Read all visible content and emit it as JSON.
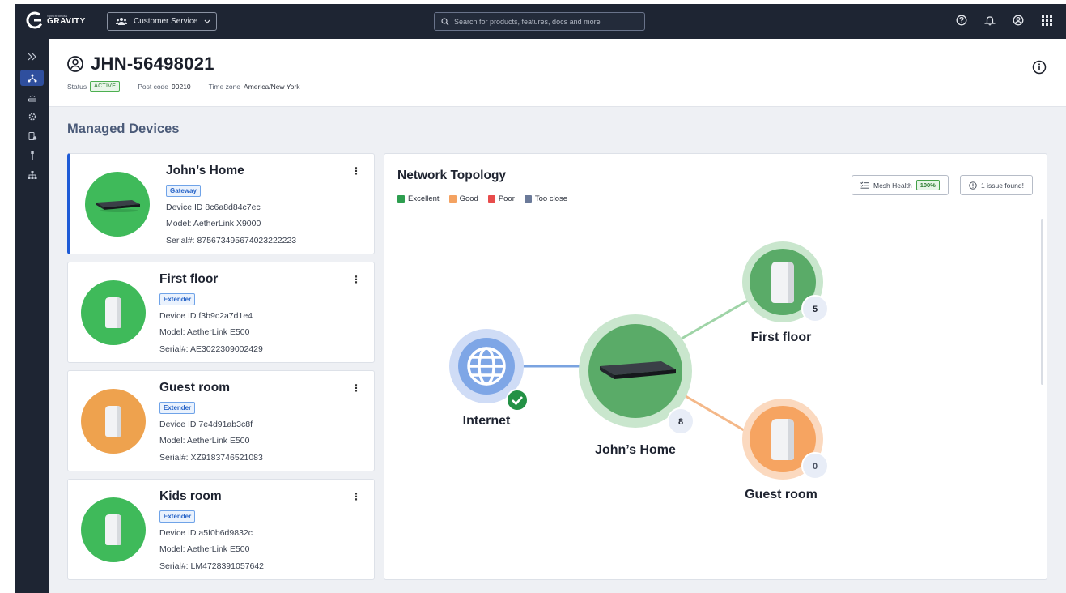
{
  "app": {
    "brand_small": "Synchronoss",
    "brand_name": "GRAVITY",
    "context_label": "Customer Service",
    "search_placeholder": "Search for products, features, docs and more"
  },
  "account": {
    "id": "JHN-56498021",
    "status_label": "Status",
    "status_value": "ACTIVE",
    "postcode_label": "Post code",
    "postcode_value": "90210",
    "timezone_label": "Time zone",
    "timezone_value": "America/New York"
  },
  "section_title": "Managed Devices",
  "devices": [
    {
      "name": "John’s Home",
      "type": "Gateway",
      "device_id": "Device ID 8c6a8d84c7ec",
      "model": "Model: AetherLink X9000",
      "serial": "Serial#: 875673495674023222223",
      "status_color": "#3fba5a"
    },
    {
      "name": "First floor",
      "type": "Extender",
      "device_id": "Device ID f3b9c2a7d1e4",
      "model": "Model: AetherLink E500",
      "serial": "Serial#: AE3022309002429",
      "status_color": "#3fba5a"
    },
    {
      "name": "Guest room",
      "type": "Extender",
      "device_id": "Device ID 7e4d91ab3c8f",
      "model": "Model: AetherLink E500",
      "serial": "Serial#: XZ9183746521083",
      "status_color": "#eea24e"
    },
    {
      "name": "Kids room",
      "type": "Extender",
      "device_id": "Device ID a5f0b6d9832c",
      "model": "Model: AetherLink E500",
      "serial": "Serial#: LM4728391057642",
      "status_color": "#3fba5a"
    }
  ],
  "topology": {
    "title": "Network Topology",
    "legend": [
      {
        "label": "Excellent",
        "color": "#2e9e4f"
      },
      {
        "label": "Good",
        "color": "#f4a261"
      },
      {
        "label": "Poor",
        "color": "#e84c4c"
      },
      {
        "label": "Too close",
        "color": "#6b7a99"
      }
    ],
    "mesh_health_label": "Mesh Health",
    "mesh_health_value": "100%",
    "issues_label": "1 issue found!",
    "nodes": {
      "internet": {
        "label": "Internet"
      },
      "gateway": {
        "label": "John’s Home",
        "clients": "8"
      },
      "first_floor": {
        "label": "First floor",
        "clients": "5"
      },
      "guest_room": {
        "label": "Guest room",
        "clients": "0"
      }
    }
  }
}
